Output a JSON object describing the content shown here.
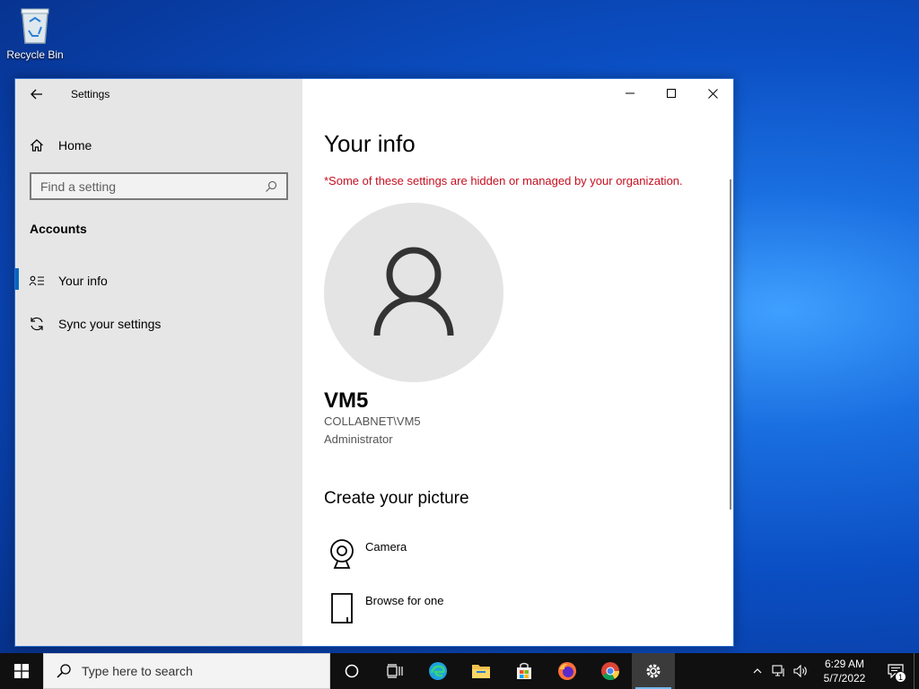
{
  "desktop": {
    "recycle_bin_label": "Recycle Bin"
  },
  "window": {
    "title": "Settings",
    "sidebar": {
      "home_label": "Home",
      "search_placeholder": "Find a setting",
      "section_label": "Accounts",
      "items": [
        {
          "label": "Your info",
          "active": true,
          "icon": "contact-card-icon"
        },
        {
          "label": "Sync your settings",
          "active": false,
          "icon": "sync-icon"
        }
      ]
    },
    "content": {
      "heading": "Your info",
      "warning": "*Some of these settings are hidden or managed by your organization.",
      "user": {
        "name": "VM5",
        "domain_account": "COLLABNET\\VM5",
        "role": "Administrator"
      },
      "picture_heading": "Create your picture",
      "options": [
        {
          "label": "Camera",
          "icon": "webcam-icon"
        },
        {
          "label": "Browse for one",
          "icon": "document-icon"
        }
      ]
    }
  },
  "taskbar": {
    "search_placeholder": "Type here to search",
    "apps": [
      "task-view-icon",
      "edge-icon",
      "file-explorer-icon",
      "store-icon",
      "firefox-icon",
      "chrome-icon",
      "settings-icon"
    ],
    "clock": {
      "time": "6:29 AM",
      "date": "5/7/2022"
    },
    "notification_count": "1"
  },
  "colors": {
    "accent": "#0067c0",
    "warning": "#c50f1f",
    "sidebar_bg": "#e6e6e6",
    "taskbar_bg": "#101010"
  }
}
